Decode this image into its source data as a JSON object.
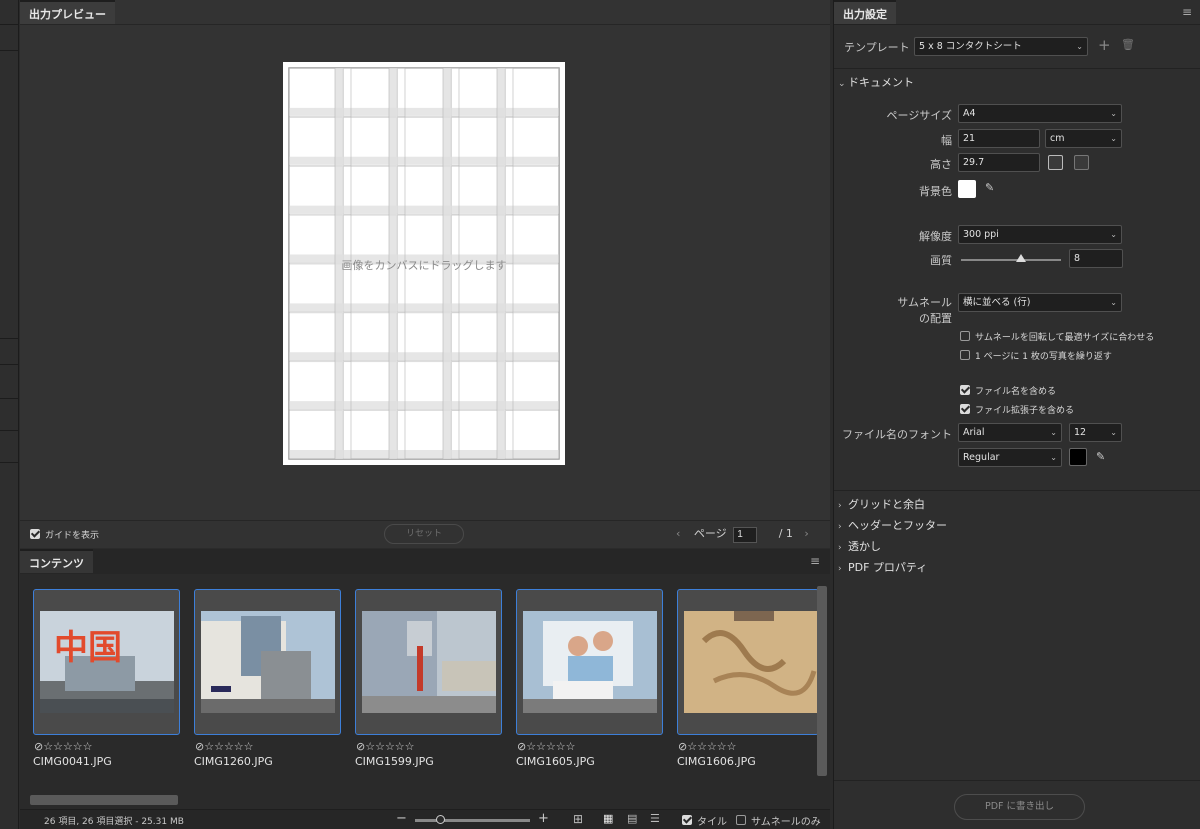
{
  "preview": {
    "tab": "出力プレビュー",
    "drop_hint": "画像をカンバスにドラッグします",
    "show_guides": "ガイドを表示",
    "reset": "リセット",
    "page_label": "ページ",
    "page_current": "1",
    "page_total": "/ 1"
  },
  "content": {
    "tab": "コンテンツ",
    "items": [
      {
        "file": "CIMG0041.JPG",
        "stars": "☆☆☆☆☆"
      },
      {
        "file": "CIMG1260.JPG",
        "stars": "☆☆☆☆☆"
      },
      {
        "file": "CIMG1599.JPG",
        "stars": "☆☆☆☆☆"
      },
      {
        "file": "CIMG1605.JPG",
        "stars": "☆☆☆☆☆"
      },
      {
        "file": "CIMG1606.JPG",
        "stars": "☆☆☆☆☆"
      }
    ],
    "status": "26 項目, 26 項目選択 - 25.31 MB",
    "zoom_minus": "−",
    "zoom_plus": "+",
    "tile_label": "タイル",
    "thumb_only_label": "サムネールのみ"
  },
  "settings": {
    "tab": "出力設定",
    "template_label": "テンプレート",
    "template_value": "5 x 8 コンタクトシート",
    "document_section": "ドキュメント",
    "page_size_label": "ページサイズ",
    "page_size_value": "A4",
    "width_label": "幅",
    "width_value": "21",
    "unit_value": "cm",
    "height_label": "高さ",
    "height_value": "29.7",
    "bg_label": "背景色",
    "resolution_label": "解像度",
    "resolution_value": "300 ppi",
    "quality_label": "画質",
    "quality_value": "8",
    "quality_level": 0.6,
    "layout_label_1": "サムネールの",
    "layout_label_2": "の配置",
    "layout_label_1b": "サムネール",
    "layout_value": "横に並べる (行)",
    "rotate_opt": "サムネールを回転して最適サイズに合わせる",
    "repeat_opt": "1 ページに 1 枚の写真を繰り返す",
    "include_name_opt": "ファイル名を含める",
    "include_ext_opt": "ファイル拡張子を含める",
    "font_label": "ファイル名のフォント",
    "font_value": "Arial",
    "font_size_value": "12",
    "font_style_value": "Regular",
    "grid_section": "グリッドと余白",
    "header_section": "ヘッダーとフッター",
    "watermark_section": "透かし",
    "pdf_section": "PDF プロパティ",
    "export_button": "PDF に書き出し"
  },
  "colors": {
    "accent": "#3d7fd9",
    "panel": "#2e2e2e"
  }
}
